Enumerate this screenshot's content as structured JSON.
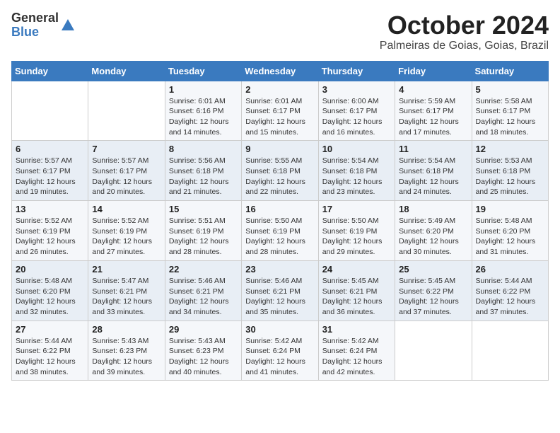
{
  "header": {
    "logo_general": "General",
    "logo_blue": "Blue",
    "title": "October 2024",
    "subtitle": "Palmeiras de Goias, Goias, Brazil"
  },
  "days_of_week": [
    "Sunday",
    "Monday",
    "Tuesday",
    "Wednesday",
    "Thursday",
    "Friday",
    "Saturday"
  ],
  "weeks": [
    [
      {
        "day": "",
        "info": ""
      },
      {
        "day": "",
        "info": ""
      },
      {
        "day": "1",
        "info": "Sunrise: 6:01 AM\nSunset: 6:16 PM\nDaylight: 12 hours and 14 minutes."
      },
      {
        "day": "2",
        "info": "Sunrise: 6:01 AM\nSunset: 6:17 PM\nDaylight: 12 hours and 15 minutes."
      },
      {
        "day": "3",
        "info": "Sunrise: 6:00 AM\nSunset: 6:17 PM\nDaylight: 12 hours and 16 minutes."
      },
      {
        "day": "4",
        "info": "Sunrise: 5:59 AM\nSunset: 6:17 PM\nDaylight: 12 hours and 17 minutes."
      },
      {
        "day": "5",
        "info": "Sunrise: 5:58 AM\nSunset: 6:17 PM\nDaylight: 12 hours and 18 minutes."
      }
    ],
    [
      {
        "day": "6",
        "info": "Sunrise: 5:57 AM\nSunset: 6:17 PM\nDaylight: 12 hours and 19 minutes."
      },
      {
        "day": "7",
        "info": "Sunrise: 5:57 AM\nSunset: 6:17 PM\nDaylight: 12 hours and 20 minutes."
      },
      {
        "day": "8",
        "info": "Sunrise: 5:56 AM\nSunset: 6:18 PM\nDaylight: 12 hours and 21 minutes."
      },
      {
        "day": "9",
        "info": "Sunrise: 5:55 AM\nSunset: 6:18 PM\nDaylight: 12 hours and 22 minutes."
      },
      {
        "day": "10",
        "info": "Sunrise: 5:54 AM\nSunset: 6:18 PM\nDaylight: 12 hours and 23 minutes."
      },
      {
        "day": "11",
        "info": "Sunrise: 5:54 AM\nSunset: 6:18 PM\nDaylight: 12 hours and 24 minutes."
      },
      {
        "day": "12",
        "info": "Sunrise: 5:53 AM\nSunset: 6:18 PM\nDaylight: 12 hours and 25 minutes."
      }
    ],
    [
      {
        "day": "13",
        "info": "Sunrise: 5:52 AM\nSunset: 6:19 PM\nDaylight: 12 hours and 26 minutes."
      },
      {
        "day": "14",
        "info": "Sunrise: 5:52 AM\nSunset: 6:19 PM\nDaylight: 12 hours and 27 minutes."
      },
      {
        "day": "15",
        "info": "Sunrise: 5:51 AM\nSunset: 6:19 PM\nDaylight: 12 hours and 28 minutes."
      },
      {
        "day": "16",
        "info": "Sunrise: 5:50 AM\nSunset: 6:19 PM\nDaylight: 12 hours and 28 minutes."
      },
      {
        "day": "17",
        "info": "Sunrise: 5:50 AM\nSunset: 6:19 PM\nDaylight: 12 hours and 29 minutes."
      },
      {
        "day": "18",
        "info": "Sunrise: 5:49 AM\nSunset: 6:20 PM\nDaylight: 12 hours and 30 minutes."
      },
      {
        "day": "19",
        "info": "Sunrise: 5:48 AM\nSunset: 6:20 PM\nDaylight: 12 hours and 31 minutes."
      }
    ],
    [
      {
        "day": "20",
        "info": "Sunrise: 5:48 AM\nSunset: 6:20 PM\nDaylight: 12 hours and 32 minutes."
      },
      {
        "day": "21",
        "info": "Sunrise: 5:47 AM\nSunset: 6:21 PM\nDaylight: 12 hours and 33 minutes."
      },
      {
        "day": "22",
        "info": "Sunrise: 5:46 AM\nSunset: 6:21 PM\nDaylight: 12 hours and 34 minutes."
      },
      {
        "day": "23",
        "info": "Sunrise: 5:46 AM\nSunset: 6:21 PM\nDaylight: 12 hours and 35 minutes."
      },
      {
        "day": "24",
        "info": "Sunrise: 5:45 AM\nSunset: 6:21 PM\nDaylight: 12 hours and 36 minutes."
      },
      {
        "day": "25",
        "info": "Sunrise: 5:45 AM\nSunset: 6:22 PM\nDaylight: 12 hours and 37 minutes."
      },
      {
        "day": "26",
        "info": "Sunrise: 5:44 AM\nSunset: 6:22 PM\nDaylight: 12 hours and 37 minutes."
      }
    ],
    [
      {
        "day": "27",
        "info": "Sunrise: 5:44 AM\nSunset: 6:22 PM\nDaylight: 12 hours and 38 minutes."
      },
      {
        "day": "28",
        "info": "Sunrise: 5:43 AM\nSunset: 6:23 PM\nDaylight: 12 hours and 39 minutes."
      },
      {
        "day": "29",
        "info": "Sunrise: 5:43 AM\nSunset: 6:23 PM\nDaylight: 12 hours and 40 minutes."
      },
      {
        "day": "30",
        "info": "Sunrise: 5:42 AM\nSunset: 6:24 PM\nDaylight: 12 hours and 41 minutes."
      },
      {
        "day": "31",
        "info": "Sunrise: 5:42 AM\nSunset: 6:24 PM\nDaylight: 12 hours and 42 minutes."
      },
      {
        "day": "",
        "info": ""
      },
      {
        "day": "",
        "info": ""
      }
    ]
  ]
}
